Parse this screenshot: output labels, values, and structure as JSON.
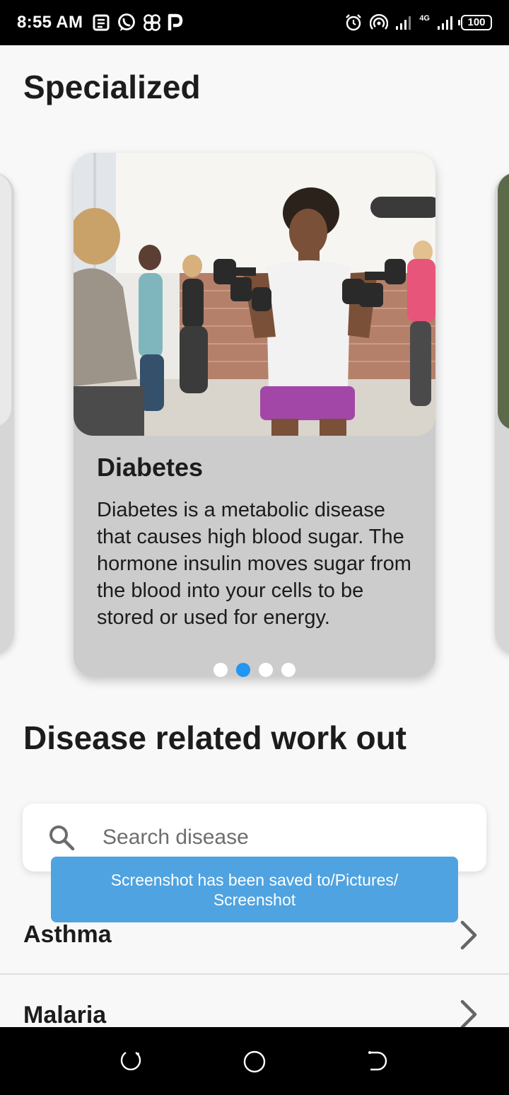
{
  "status_bar": {
    "time": "8:55 AM",
    "notification_icons": [
      "news-icon",
      "whatsapp-icon",
      "pinwheel-icon",
      "p-app-icon"
    ],
    "right_icons": [
      "alarm-icon",
      "hotspot-icon",
      "signal-icon",
      "signal-4g-icon"
    ],
    "network_type": "4G",
    "battery": "100"
  },
  "specialized": {
    "title": "Specialized",
    "card": {
      "title": "Diabetes",
      "description": "Diabetes is a metabolic disease that causes high blood sugar. The hormone insulin moves sugar from the blood into your cells to be stored or used for energy."
    },
    "page_count": 4,
    "active_page": 1
  },
  "workout": {
    "title": "Disease related work out",
    "search": {
      "placeholder": "Search disease",
      "value": ""
    },
    "items": [
      {
        "label": "Asthma"
      },
      {
        "label": "Malaria"
      }
    ]
  },
  "toast": {
    "message": "Screenshot has been saved to/Pictures/ Screenshot"
  },
  "colors": {
    "accent": "#2196f3",
    "toast": "#4fa3e1",
    "card": "#cccccc",
    "background": "#f8f8f8"
  }
}
